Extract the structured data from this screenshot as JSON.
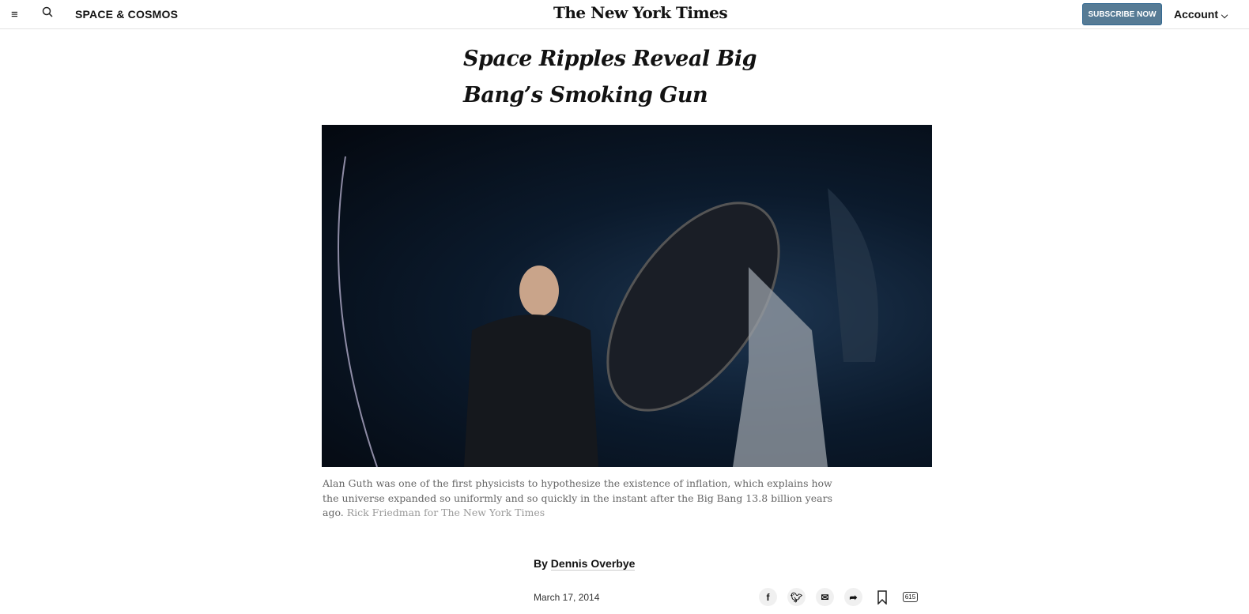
{
  "header": {
    "section": "SPACE & COSMOS",
    "logo": "The New York Times",
    "subscribe": "SUBSCRIBE NOW",
    "account": "Account"
  },
  "article": {
    "title": "Space Ripples Reveal Big Bang’s Smoking Gun",
    "caption": "Alan Guth was one of the first physicists to hypothesize the existence of inflation, which explains how the universe expanded so uniformly and so quickly in the instant after the Big Bang 13.8 billion years ago.",
    "credit": "Rick Friedman for The New York Times",
    "byline_prefix": "By",
    "author": "Dennis Overbye",
    "date": "March 17, 2014",
    "comment_count": "615"
  }
}
